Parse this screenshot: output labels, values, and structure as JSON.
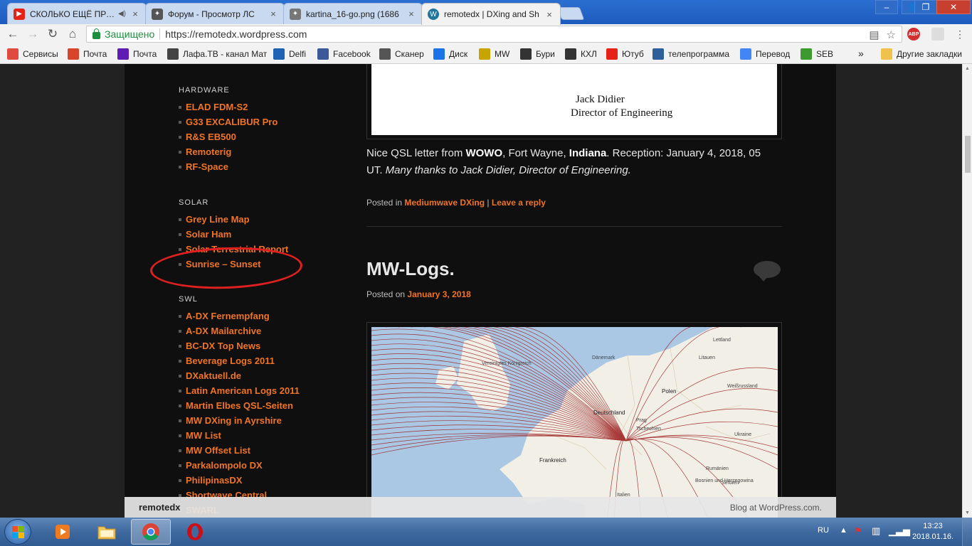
{
  "browser": {
    "tabs": [
      {
        "title": "СКОЛЬКО ЕЩЁ ПРОД",
        "icon": "youtube-icon",
        "active": false
      },
      {
        "title": "Форум - Просмотр ЛС",
        "icon": "forum-icon",
        "active": false
      },
      {
        "title": "kartina_16-go.png (1686",
        "icon": "image-icon",
        "active": false
      },
      {
        "title": "remotedx | DXing and Sh",
        "icon": "wordpress-icon",
        "active": true
      }
    ],
    "security_label": "Защищено",
    "url": "https://remotedx.wordpress.com",
    "extensions": [
      "ABP"
    ]
  },
  "bookmarks": [
    {
      "label": "Сервисы",
      "icon": "apps-icon",
      "color": "#e04a3f"
    },
    {
      "label": "Почта",
      "icon": "mail-icon",
      "color": "#d8452b"
    },
    {
      "label": "Почта",
      "icon": "yahoo-mail-icon",
      "color": "#5f1bb3"
    },
    {
      "label": "Лафа.ТВ - канал Мат",
      "icon": "tv-icon",
      "color": "#444444"
    },
    {
      "label": "Delfi",
      "icon": "delfi-icon",
      "color": "#1f63b4"
    },
    {
      "label": "Facebook",
      "icon": "facebook-icon",
      "color": "#3b5998"
    },
    {
      "label": "Сканер",
      "icon": "scanner-icon",
      "color": "#555555"
    },
    {
      "label": "Диск",
      "icon": "disk-icon",
      "color": "#1b73e8"
    },
    {
      "label": "MW",
      "icon": "mw-icon",
      "color": "#c8a400"
    },
    {
      "label": "Бури",
      "icon": "storm-icon",
      "color": "#333333"
    },
    {
      "label": "КХЛ",
      "icon": "khl-icon",
      "color": "#333333"
    },
    {
      "label": "Ютуб",
      "icon": "youtube-icon",
      "color": "#e62117"
    },
    {
      "label": "телепрограмма",
      "icon": "monitor-icon",
      "color": "#2d5f9a"
    },
    {
      "label": "Перевод",
      "icon": "translate-icon",
      "color": "#4285f4"
    },
    {
      "label": "SEB",
      "icon": "seb-icon",
      "color": "#3d9a2f"
    }
  ],
  "bookmarks_more": "»",
  "bookmarks_other": "Другие закладки",
  "sidebar": {
    "sections": [
      {
        "heading": "HARDWARE",
        "items": [
          "ELAD FDM-S2",
          "G33 EXCALIBUR Pro",
          "R&S EB500",
          "Remoterig",
          "RF-Space"
        ]
      },
      {
        "heading": "SOLAR",
        "items": [
          "Grey Line Map",
          "Solar Ham",
          "Solar Terrestrial Report",
          "Sunrise – Sunset"
        ]
      },
      {
        "heading": "SWL",
        "items": [
          "A-DX Fernempfang",
          "A-DX Mailarchive",
          "BC-DX Top News",
          "Beverage Logs 2011",
          "DXaktuell.de",
          "Latin American Logs 2011",
          "Martin Elbes QSL-Seiten",
          "MW DXing in Ayrshire",
          "MW List",
          "MW Offset List",
          "Parkalompolo DX",
          "PhilipinasDX",
          "Shortwave Central",
          "SWARL"
        ]
      }
    ]
  },
  "letter": {
    "name": "Jack Didier",
    "title": "Director of Engineering"
  },
  "post1": {
    "text_a": "Nice QSL letter from ",
    "text_b": "WOWO",
    "text_c": ", Fort Wayne, ",
    "text_d": "Indiana",
    "text_e": ". Reception: January 4, 2018, 05 UT. ",
    "text_f": "Many thanks to Jack Didier, Director of Engineering.",
    "posted_in": "Posted in",
    "category": "Mediumwave DXing",
    "divider": "|",
    "reply": "Leave a reply"
  },
  "post2": {
    "title": "MW-Logs.",
    "posted_on": "Posted on",
    "date": "January 3, 2018"
  },
  "map_labels": [
    "Lettland",
    "Dänemark",
    "Litauen",
    "Vereinigtes Königreich",
    "Weißrussland",
    "Polen",
    "Deutschland",
    "Prag",
    "Tschechien",
    "Ukraine",
    "Frankreich",
    "Rumänien",
    "Bosnien und Herzegowina",
    "Serbien",
    "Italien"
  ],
  "footer": {
    "site": "remotedx",
    "credit": "Blog at WordPress.com."
  },
  "taskbar": {
    "lang": "RU",
    "time": "13:23",
    "date": "2018.01.16."
  },
  "colors": {
    "accent": "#ef7426",
    "annotation": "#e02020"
  }
}
